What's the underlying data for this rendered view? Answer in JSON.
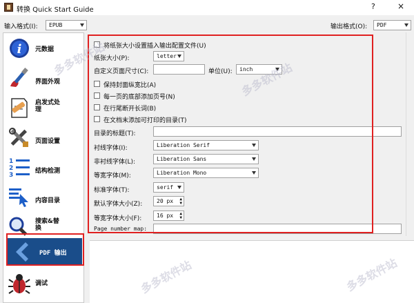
{
  "window": {
    "title": "转换 Quick Start Guide",
    "help": "?",
    "close": "×"
  },
  "formats": {
    "input_label": "输入格式(I):",
    "input_value": "EPUB",
    "output_label": "输出格式(O):",
    "output_value": "PDF"
  },
  "sidebar": {
    "items": [
      {
        "label": "元数据",
        "icon": "info-icon"
      },
      {
        "label": "界面外观",
        "icon": "paintbrush-icon"
      },
      {
        "label": "启发式处理",
        "icon": "document-bandage-icon"
      },
      {
        "label": "页面设置",
        "icon": "tools-icon"
      },
      {
        "label": "结构检测",
        "icon": "numbered-list-icon"
      },
      {
        "label": "内容目录",
        "icon": "toc-pointer-icon"
      },
      {
        "label": "搜索&替换",
        "icon": "magnifier-icon"
      },
      {
        "label": "PDF 输出",
        "icon": "pdf-back-arrow-icon"
      },
      {
        "label": "调试",
        "icon": "bug-icon"
      }
    ],
    "selected": "PDF 输出"
  },
  "options": {
    "chk_paper_size": "将纸张大小设置插入输出配置文件(U)",
    "paper_size_label": "纸张大小(P):",
    "paper_size_value": "letter",
    "custom_size_label": "自定义页面尺寸(C):",
    "unit_label": "单位(U):",
    "unit_value": "inch",
    "chk_aspect": "保持封面纵宽比(A)",
    "chk_page_numbers": "每一页的底部添加页号(N)",
    "chk_break_words": "在行尾断开长词(B)",
    "chk_printable_toc": "在文档末添加可打印的目录(T)",
    "toc_title_label": "目录的标题(T):",
    "serif_label": "衬线字体(I):",
    "serif_value": "Liberation Serif",
    "sans_label": "非衬线字体(L):",
    "sans_value": "Liberation Sans",
    "mono_label": "等宽字体(M):",
    "mono_value": "Liberation Mono",
    "standard_label": "标准字体(T):",
    "standard_value": "serif",
    "default_size_label": "默认字体大小(Z):",
    "default_size_value": "20 px",
    "mono_size_label": "等宽字体大小(F):",
    "mono_size_value": "16 px",
    "page_number_map_label": "Page number map:"
  },
  "colors": {
    "highlight_red": "#e02020",
    "selected_blue": "#1a4d8a"
  },
  "watermark": "多多软件站"
}
